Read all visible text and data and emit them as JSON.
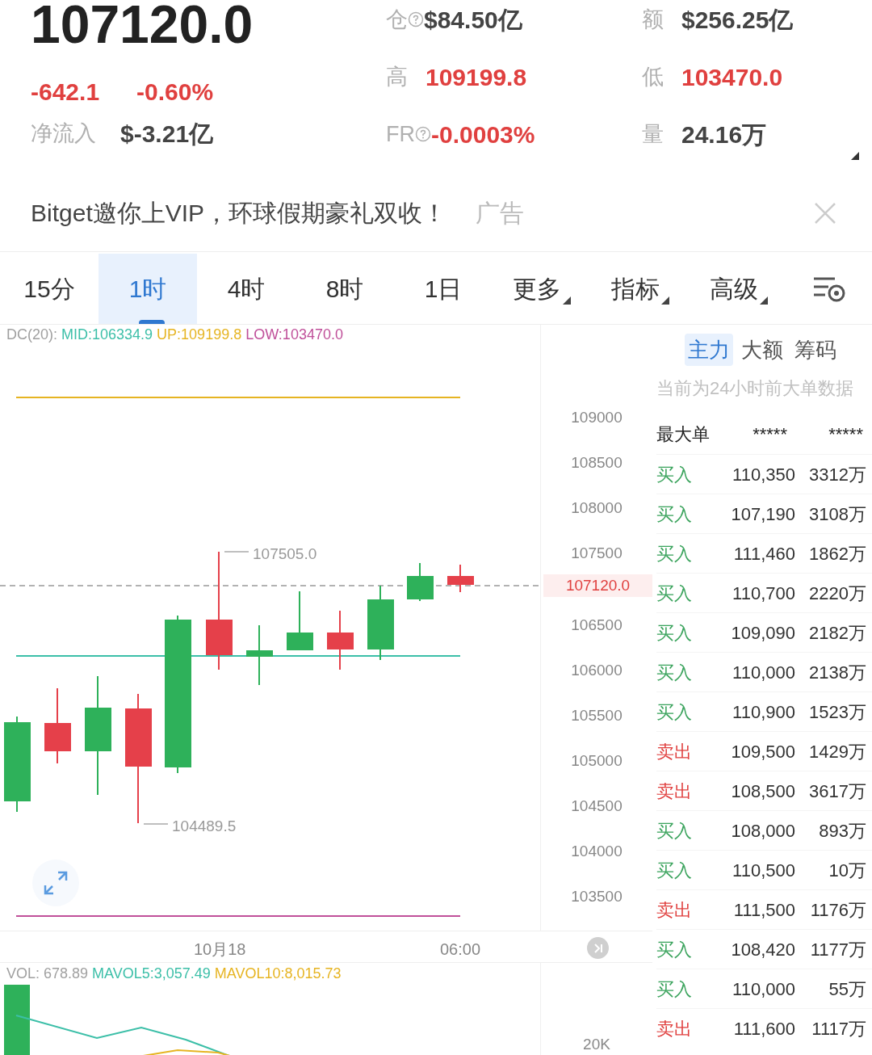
{
  "ticker": {
    "price": "107120.0",
    "change": "-642.1",
    "change_pct": "-0.60%",
    "net_inflow": {
      "label": "净流入",
      "value": "$-3.21亿"
    }
  },
  "stats": [
    {
      "label": "仓",
      "help": true,
      "value": "$84.50亿",
      "color": "#444444"
    },
    {
      "label": "额",
      "help": false,
      "value": "$256.25亿",
      "color": "#444444"
    },
    {
      "label": "高",
      "help": false,
      "value": "109199.8",
      "color": "#e0403f"
    },
    {
      "label": "低",
      "help": false,
      "value": "103470.0",
      "color": "#e0403f"
    },
    {
      "label": "FR",
      "help": true,
      "value": "-0.0003%",
      "color": "#e0403f"
    },
    {
      "label": "量",
      "help": false,
      "value": "24.16万",
      "color": "#444444"
    }
  ],
  "ad": {
    "text": "Bitget邀你上VIP，环球假期豪礼双收！",
    "tag": "广告"
  },
  "intervals": [
    {
      "label": "15分",
      "selected": false,
      "dropdown": false
    },
    {
      "label": "1时",
      "selected": true,
      "dropdown": false
    },
    {
      "label": "4时",
      "selected": false,
      "dropdown": false
    },
    {
      "label": "8时",
      "selected": false,
      "dropdown": false
    },
    {
      "label": "1日",
      "selected": false,
      "dropdown": false
    },
    {
      "label": "更多",
      "selected": false,
      "dropdown": true
    },
    {
      "label": "指标",
      "selected": false,
      "dropdown": true
    },
    {
      "label": "高级",
      "selected": false,
      "dropdown": true
    }
  ],
  "indicator_legend": [
    {
      "text": "DC(20):",
      "color": "#a0a0a0"
    },
    {
      "text": "MID:106334.9",
      "color": "#3cbfa8"
    },
    {
      "text": "UP:109199.8",
      "color": "#e6b422"
    },
    {
      "text": "LOW:103470.0",
      "color": "#c0509a"
    }
  ],
  "price_axis": {
    "upper": [
      "109000",
      "108500",
      "108000",
      "107500"
    ],
    "lower": [
      "106500",
      "106000",
      "105500",
      "105000",
      "104500",
      "104000",
      "103500"
    ]
  },
  "current_price_tag": "107120.0",
  "high_marker": "107505.0",
  "low_marker": "104489.5",
  "time_axis": [
    "10月18",
    "06:00"
  ],
  "volume_legend": [
    {
      "text": "VOL: 678.89",
      "color": "#a0a0a0"
    },
    {
      "text": "MAVOL5:3,057.49",
      "color": "#3cbfa8"
    },
    {
      "text": "MAVOL10:8,015.73",
      "color": "#e6b422"
    }
  ],
  "volume_axis": [
    "20K"
  ],
  "big_orders": {
    "tabs": [
      {
        "label": "主力",
        "selected": true
      },
      {
        "label": "大额",
        "selected": false
      },
      {
        "label": "筹码",
        "selected": false
      }
    ],
    "note": "当前为24小时前大单数据",
    "header": [
      "最大单",
      "*****",
      "*****"
    ],
    "rows": [
      {
        "side": "买入",
        "kind": "buy",
        "price": "110,350",
        "amount": "3312万"
      },
      {
        "side": "买入",
        "kind": "buy",
        "price": "107,190",
        "amount": "3108万"
      },
      {
        "side": "买入",
        "kind": "buy",
        "price": "111,460",
        "amount": "1862万"
      },
      {
        "side": "买入",
        "kind": "buy",
        "price": "110,700",
        "amount": "2220万"
      },
      {
        "side": "买入",
        "kind": "buy",
        "price": "109,090",
        "amount": "2182万"
      },
      {
        "side": "买入",
        "kind": "buy",
        "price": "110,000",
        "amount": "2138万"
      },
      {
        "side": "买入",
        "kind": "buy",
        "price": "110,900",
        "amount": "1523万"
      },
      {
        "side": "卖出",
        "kind": "sell",
        "price": "109,500",
        "amount": "1429万"
      },
      {
        "side": "卖出",
        "kind": "sell",
        "price": "108,500",
        "amount": "3617万"
      },
      {
        "side": "买入",
        "kind": "buy",
        "price": "108,000",
        "amount": "893万"
      },
      {
        "side": "买入",
        "kind": "buy",
        "price": "110,500",
        "amount": "10万"
      },
      {
        "side": "卖出",
        "kind": "sell",
        "price": "111,500",
        "amount": "1176万"
      },
      {
        "side": "买入",
        "kind": "buy",
        "price": "108,420",
        "amount": "1177万"
      },
      {
        "side": "买入",
        "kind": "buy",
        "price": "110,000",
        "amount": "55万"
      },
      {
        "side": "卖出",
        "kind": "sell",
        "price": "111,600",
        "amount": "1117万"
      }
    ]
  }
}
